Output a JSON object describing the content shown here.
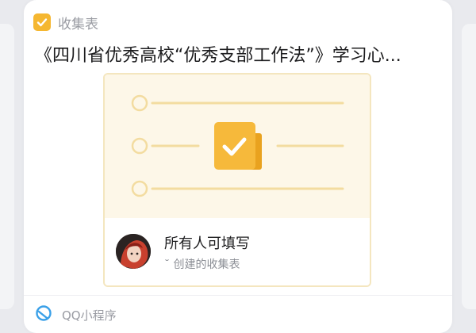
{
  "card": {
    "app_name": "收集表",
    "title": "《四川省优秀高校“优秀支部工作法”》学习心...",
    "preview": {
      "fill_label": "所有人可填写",
      "creator_label": "˘ 创建的收集表"
    },
    "bottom": {
      "label": "QQ小程序"
    }
  },
  "colors": {
    "accent": "#f5b731",
    "preview_bg": "#fdf7e8",
    "preview_border": "#f4e6bf",
    "mini_program_icon": "#3aa0e8"
  },
  "icons": {
    "app": "check-square-icon",
    "doc": "checklist-document-icon",
    "mini_program": "qq-mini-program-icon"
  }
}
